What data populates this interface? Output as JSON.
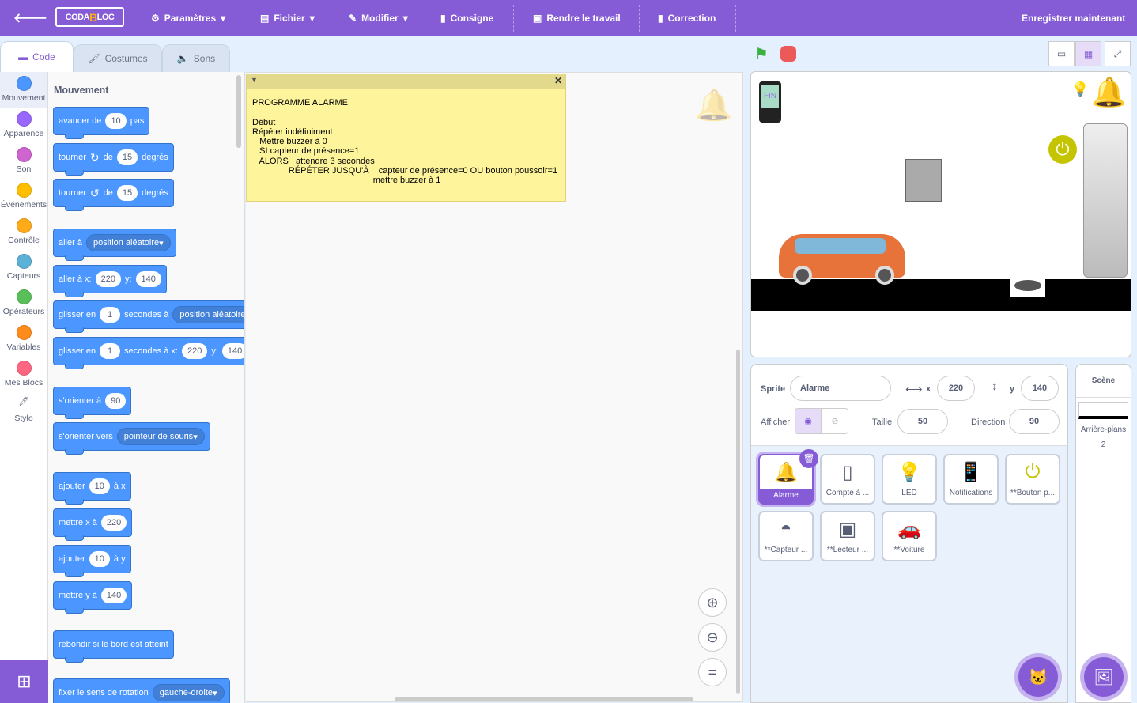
{
  "topbar": {
    "logo": "CODABLOC",
    "items": [
      {
        "label": "Paramètres",
        "icon": "gear-icon"
      },
      {
        "label": "Fichier",
        "icon": "file-icon"
      },
      {
        "label": "Modifier",
        "icon": "pencil-icon"
      },
      {
        "label": "Consigne",
        "icon": "clipboard-icon"
      },
      {
        "label": "Rendre le travail",
        "icon": "submit-icon"
      },
      {
        "label": "Correction",
        "icon": "clipboard-check-icon"
      }
    ],
    "save": "Enregistrer maintenant"
  },
  "tabs": [
    {
      "label": "Code"
    },
    {
      "label": "Costumes"
    },
    {
      "label": "Sons"
    }
  ],
  "categories": [
    {
      "label": "Mouvement",
      "color": "#4c97ff"
    },
    {
      "label": "Apparence",
      "color": "#9966ff"
    },
    {
      "label": "Son",
      "color": "#cf63cf"
    },
    {
      "label": "Événements",
      "color": "#ffbf00"
    },
    {
      "label": "Contrôle",
      "color": "#ffab19"
    },
    {
      "label": "Capteurs",
      "color": "#5cb1d6"
    },
    {
      "label": "Opérateurs",
      "color": "#59c059"
    },
    {
      "label": "Variables",
      "color": "#ff8c1a"
    },
    {
      "label": "Mes Blocs",
      "color": "#ff6680"
    },
    {
      "label": "Stylo",
      "color": ""
    }
  ],
  "palette": {
    "title": "Mouvement",
    "blocks": [
      [
        {
          "t": "avancer de"
        },
        {
          "n": "10"
        },
        {
          "t": "pas"
        }
      ],
      [
        {
          "t": "tourner"
        },
        {
          "i": "↻"
        },
        {
          "t": "de"
        },
        {
          "n": "15"
        },
        {
          "t": "degrés"
        }
      ],
      [
        {
          "t": "tourner"
        },
        {
          "i": "↺"
        },
        {
          "t": "de"
        },
        {
          "n": "15"
        },
        {
          "t": "degrés"
        }
      ],
      [
        {
          "t": "aller à"
        },
        {
          "d": "position aléatoire"
        }
      ],
      [
        {
          "t": "aller à x:"
        },
        {
          "n": "220"
        },
        {
          "t": "y:"
        },
        {
          "n": "140"
        }
      ],
      [
        {
          "t": "glisser en"
        },
        {
          "n": "1"
        },
        {
          "t": "secondes à"
        },
        {
          "d": "position aléatoire"
        }
      ],
      [
        {
          "t": "glisser en"
        },
        {
          "n": "1"
        },
        {
          "t": "secondes à x:"
        },
        {
          "n": "220"
        },
        {
          "t": "y:"
        },
        {
          "n": "140"
        }
      ],
      [
        {
          "t": "s'orienter à"
        },
        {
          "n": "90"
        }
      ],
      [
        {
          "t": "s'orienter vers"
        },
        {
          "d": "pointeur de souris"
        }
      ],
      [
        {
          "t": "ajouter"
        },
        {
          "n": "10"
        },
        {
          "t": "à x"
        }
      ],
      [
        {
          "t": "mettre x à"
        },
        {
          "n": "220"
        }
      ],
      [
        {
          "t": "ajouter"
        },
        {
          "n": "10"
        },
        {
          "t": "à y"
        }
      ],
      [
        {
          "t": "mettre y à"
        },
        {
          "n": "140"
        }
      ],
      [
        {
          "t": "rebondir si le bord est atteint"
        }
      ],
      [
        {
          "t": "fixer le sens de rotation"
        },
        {
          "d": "gauche-droite"
        }
      ]
    ]
  },
  "note": {
    "text": "PROGRAMME ALARME\n\nDébut\nRépéter indéfiniment\n   Mettre buzzer à 0\n   SI capteur de présence=1\n   ALORS   attendre 3 secondes\n               RÉPÉTER JUSQU'À    capteur de présence=0 OU bouton poussoir=1\n                                                  mettre buzzer à 1"
  },
  "stage_screen_text": "FIN",
  "sprite_info": {
    "sprite_label": "Sprite",
    "sprite_name": "Alarme",
    "x_label": "x",
    "x": "220",
    "y_label": "y",
    "y": "140",
    "show_label": "Afficher",
    "size_label": "Taille",
    "size": "50",
    "direction_label": "Direction",
    "direction": "90"
  },
  "sprites": [
    {
      "name": "Alarme",
      "selected": true
    },
    {
      "name": "Compte à ..."
    },
    {
      "name": "LED"
    },
    {
      "name": "Notifications"
    },
    {
      "name": "**Bouton p..."
    },
    {
      "name": "**Capteur ..."
    },
    {
      "name": "**Lecteur ..."
    },
    {
      "name": "**Voiture"
    }
  ],
  "scene": {
    "title": "Scène",
    "backdrops_label": "Arrière-plans",
    "backdrops_count": "2"
  },
  "colors": {
    "accent": "#855cd6",
    "motion": "#4c97ff",
    "note": "#fef49c"
  }
}
